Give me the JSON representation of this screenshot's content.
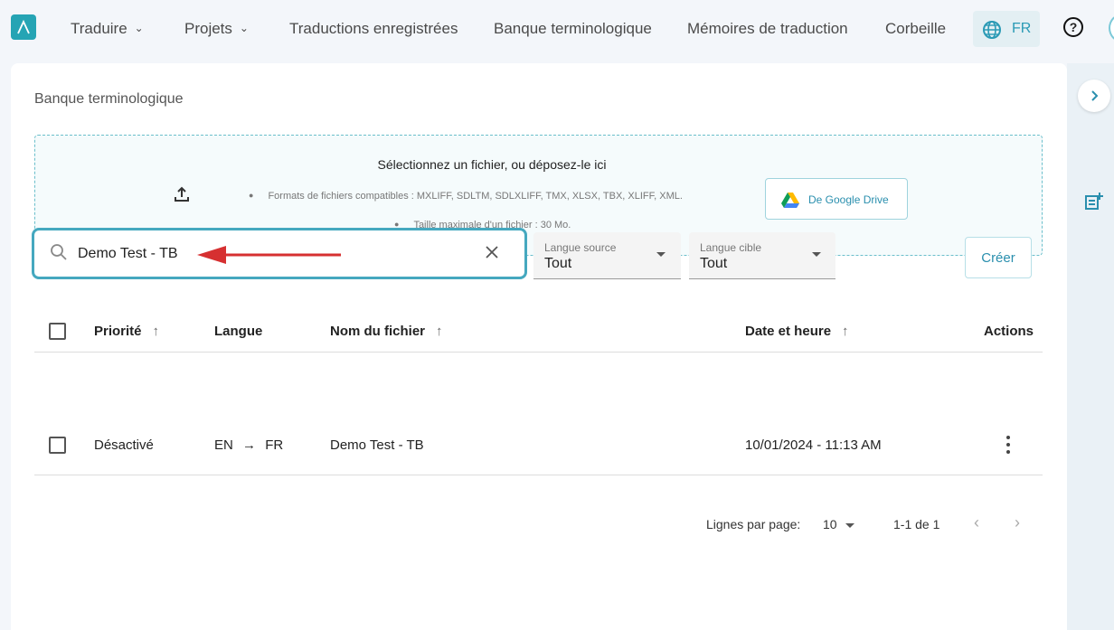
{
  "nav": {
    "items": [
      {
        "label": "Traduire",
        "has_menu": true
      },
      {
        "label": "Projets",
        "has_menu": true
      },
      {
        "label": "Traductions enregistrées"
      },
      {
        "label": "Banque terminologique"
      },
      {
        "label": "Mémoires de traduction"
      },
      {
        "label": "Corbeille"
      }
    ],
    "language": "FR",
    "help": "?"
  },
  "page": {
    "title": "Banque terminologique"
  },
  "upload": {
    "title": "Sélectionnez un fichier, ou déposez-le ici",
    "formats": "Formats de fichiers compatibles : MXLIFF, SDLTM, SDLXLIFF, TMX, XLSX, TBX, XLIFF, XML.",
    "max_size": "Taille maximale d'un fichier : 30 Mo.",
    "gdrive_label": "De Google Drive"
  },
  "filters": {
    "search_value": "Demo Test - TB",
    "source_label": "Langue source",
    "source_value": "Tout",
    "target_label": "Langue cible",
    "target_value": "Tout",
    "create_label": "Créer"
  },
  "table": {
    "headers": {
      "priority": "Priorité",
      "language": "Langue",
      "filename": "Nom du fichier",
      "datetime": "Date et heure",
      "actions": "Actions"
    },
    "rows": [
      {
        "priority": "Désactivé",
        "lang_from": "EN",
        "lang_to": "FR",
        "filename": "Demo Test - TB",
        "datetime": "10/01/2024 - 11:13 AM"
      }
    ]
  },
  "pagination": {
    "rows_per_page_label": "Lignes par page:",
    "rows_per_page": "10",
    "range": "1-1 de 1"
  },
  "colors": {
    "accent": "#2a9ab5",
    "annotation_arrow": "#d63031"
  }
}
